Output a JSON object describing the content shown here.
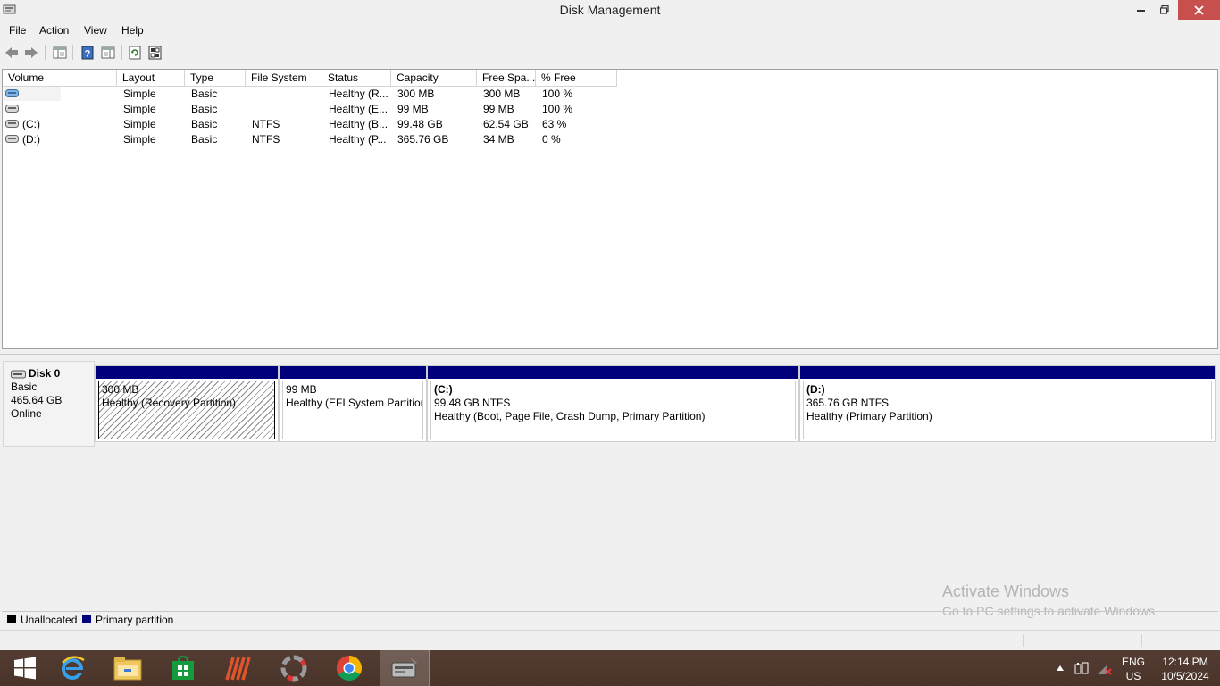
{
  "window": {
    "title": "Disk Management"
  },
  "menu": {
    "items": [
      "File",
      "Action",
      "View",
      "Help"
    ]
  },
  "toolbar": {
    "buttons": [
      "back-icon",
      "forward-icon",
      "console-tree-icon",
      "help-icon",
      "properties-icon",
      "refresh-icon",
      "rescan-icon"
    ]
  },
  "volume_list": {
    "columns": [
      "Volume",
      "Layout",
      "Type",
      "File System",
      "Status",
      "Capacity",
      "Free Spa...",
      "% Free"
    ],
    "rows": [
      {
        "volume": "",
        "layout": "Simple",
        "type": "Basic",
        "file_system": "",
        "status": "Healthy (R...",
        "capacity": "300 MB",
        "free_space": "300 MB",
        "pct_free": "100 %"
      },
      {
        "volume": "",
        "layout": "Simple",
        "type": "Basic",
        "file_system": "",
        "status": "Healthy (E...",
        "capacity": "99 MB",
        "free_space": "99 MB",
        "pct_free": "100 %"
      },
      {
        "volume": "(C:)",
        "layout": "Simple",
        "type": "Basic",
        "file_system": "NTFS",
        "status": "Healthy (B...",
        "capacity": "99.48 GB",
        "free_space": "62.54 GB",
        "pct_free": "63 %"
      },
      {
        "volume": "(D:)",
        "layout": "Simple",
        "type": "Basic",
        "file_system": "NTFS",
        "status": "Healthy (P...",
        "capacity": "365.76 GB",
        "free_space": "34 MB",
        "pct_free": "0 %"
      }
    ]
  },
  "disk": {
    "name": "Disk 0",
    "type": "Basic",
    "size": "465.64 GB",
    "state": "Online",
    "partitions": [
      {
        "label": "",
        "size": "300 MB",
        "status": "Healthy (Recovery Partition)"
      },
      {
        "label": "",
        "size": "99 MB",
        "status": "Healthy (EFI System Partitior"
      },
      {
        "label": "(C:)",
        "size": "99.48 GB NTFS",
        "status": "Healthy (Boot, Page File, Crash Dump, Primary Partition)"
      },
      {
        "label": "(D:)",
        "size": "365.76 GB NTFS",
        "status": "Healthy (Primary Partition)"
      }
    ]
  },
  "legend": {
    "unallocated": "Unallocated",
    "primary": "Primary partition",
    "unallocated_color": "#000000",
    "primary_color": "#00007d"
  },
  "watermark": {
    "title": "Activate Windows",
    "subtitle": "Go to PC settings to activate Windows."
  },
  "taskbar": {
    "apps": [
      "start-icon",
      "internet-explorer-icon",
      "file-explorer-icon",
      "store-icon",
      "app-icon",
      "app-icon-2",
      "chrome-icon",
      "disk-management-icon"
    ],
    "language": "ENG",
    "region": "US",
    "time": "12:14 PM",
    "date": "10/5/2024"
  }
}
